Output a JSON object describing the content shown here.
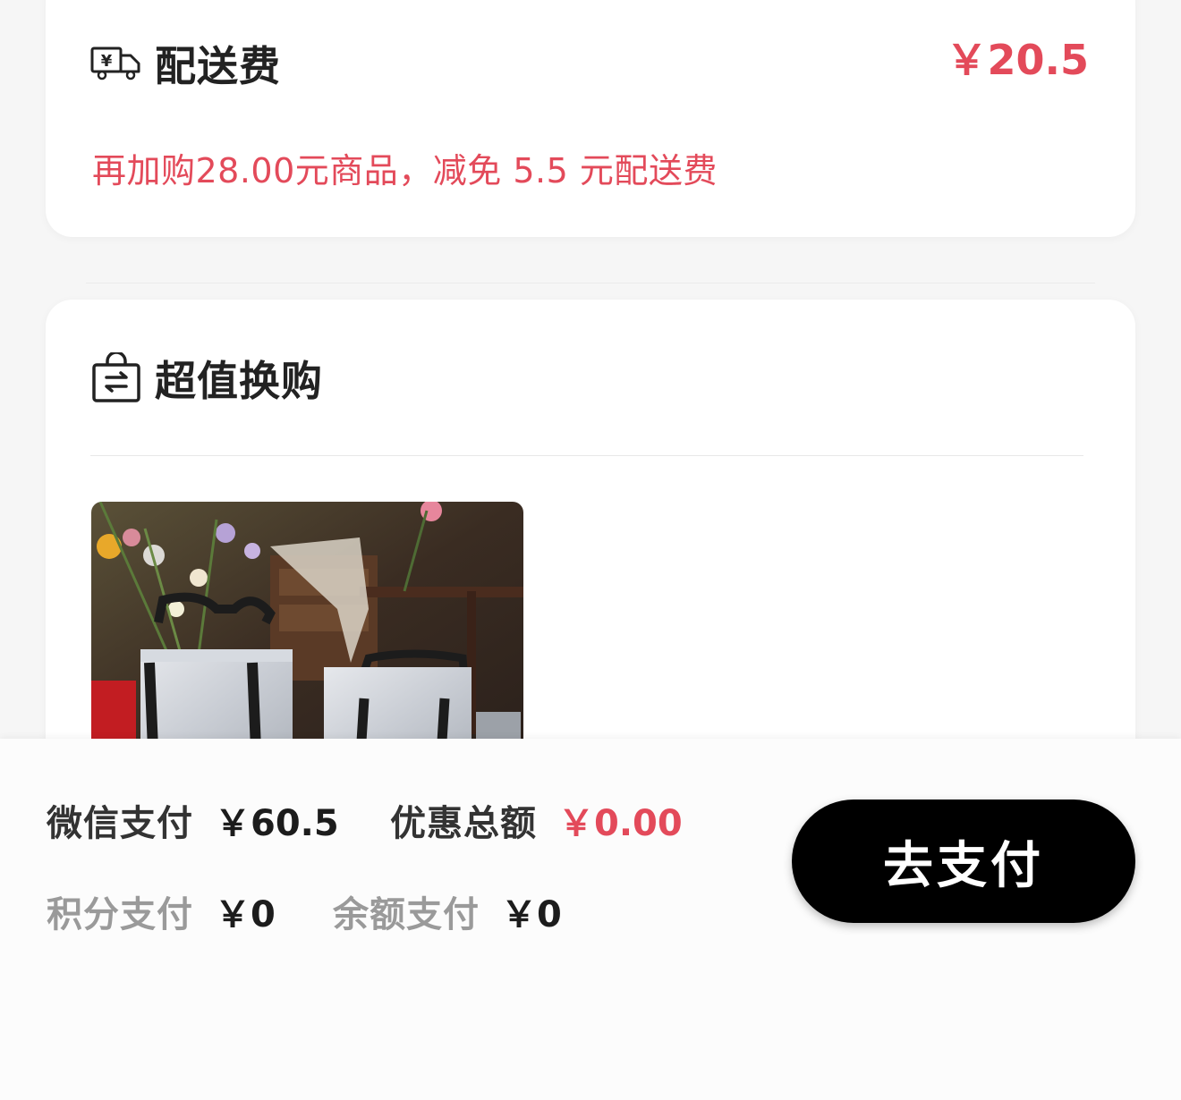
{
  "delivery": {
    "icon": "delivery-truck-yen-icon",
    "title": "配送费",
    "price": "￥20.5",
    "tip": "再加购28.00元商品，减免 5.5 元配送费"
  },
  "exchange": {
    "icon": "exchange-bag-icon",
    "title": "超值换购",
    "product_image": "silver tote bags with flowers photo"
  },
  "payment": {
    "wechat": {
      "label": "微信支付",
      "value": "￥60.5"
    },
    "discount": {
      "label": "优惠总额",
      "value": "￥0.00"
    },
    "points": {
      "label": "积分支付",
      "value": "￥0"
    },
    "balance": {
      "label": "余额支付",
      "value": "￥0"
    },
    "pay_button": "去支付"
  },
  "colors": {
    "accent_red": "#e34a5a",
    "button_black": "#000000",
    "gray_label": "#9a9a9a"
  }
}
